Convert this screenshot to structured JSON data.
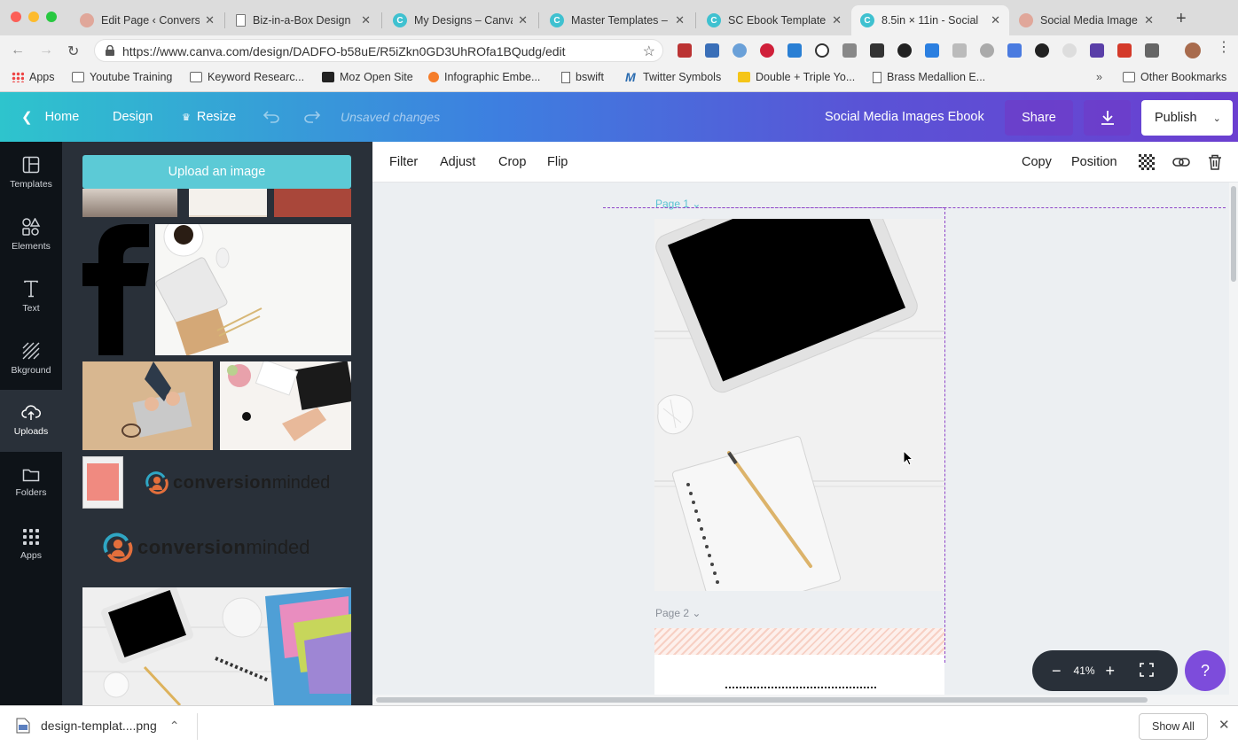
{
  "browser": {
    "tabs": [
      {
        "title": "Edit Page ‹ Conversi",
        "icon": "wordpress-icon",
        "color": "#e0a79a"
      },
      {
        "title": "Biz-in-a-Box Design",
        "icon": "document-icon",
        "color": "#ffffff"
      },
      {
        "title": "My Designs – Canva",
        "icon": "canva-icon",
        "color": "#3fc1d0"
      },
      {
        "title": "Master Templates – ",
        "icon": "canva-icon",
        "color": "#3fc1d0"
      },
      {
        "title": "SC Ebook Template",
        "icon": "canva-icon",
        "color": "#3fc1d0"
      },
      {
        "title": "8.5in × 11in - Social ",
        "icon": "canva-icon",
        "color": "#3fc1d0"
      },
      {
        "title": "Social Media Image ",
        "icon": "wordpress-icon",
        "color": "#e0a79a"
      }
    ],
    "active_tab_index": 5,
    "url": "https://www.canva.com/design/DADFO-b58uE/R5iZkn0GD3UhROfa1BQudg/edit",
    "bookmarks": [
      {
        "label": "Apps",
        "icon": "apps-grid-icon"
      },
      {
        "label": "Youtube Training",
        "icon": "folder-icon"
      },
      {
        "label": "Keyword Researc...",
        "icon": "folder-icon"
      },
      {
        "label": "Moz Open Site",
        "icon": "moz-icon"
      },
      {
        "label": "Infographic Embe...",
        "icon": "hubspot-icon"
      },
      {
        "label": "bswift",
        "icon": "page-icon"
      },
      {
        "label": "Twitter Symbols",
        "icon": "twitter-symbol-icon"
      },
      {
        "label": "Double + Triple Yo...",
        "icon": "yellow-note-icon"
      },
      {
        "label": "Brass Medallion E...",
        "icon": "page-icon"
      },
      {
        "label": "Other Bookmarks",
        "icon": "folder-icon"
      }
    ],
    "bookmarks_overflow": "»",
    "download": {
      "filename": "design-templat....png",
      "show_all": "Show All"
    }
  },
  "header": {
    "home": "Home",
    "design": "Design",
    "resize": "Resize",
    "unsaved": "Unsaved changes",
    "design_title": "Social Media Images Ebook",
    "share": "Share",
    "publish": "Publish"
  },
  "sidebar": {
    "items": [
      {
        "label": "Templates",
        "icon": "templates-icon"
      },
      {
        "label": "Elements",
        "icon": "elements-icon"
      },
      {
        "label": "Text",
        "icon": "text-icon"
      },
      {
        "label": "Bkground",
        "icon": "background-icon"
      },
      {
        "label": "Uploads",
        "icon": "upload-cloud-icon"
      },
      {
        "label": "Folders",
        "icon": "folder-icon"
      },
      {
        "label": "Apps",
        "icon": "apps-grid-icon"
      }
    ],
    "active": "Uploads"
  },
  "uploads": {
    "button": "Upload an image",
    "logo_text": {
      "main": "conversion",
      "suffix": "minded"
    }
  },
  "toolbar": {
    "left": [
      "Filter",
      "Adjust",
      "Crop",
      "Flip"
    ],
    "right": [
      "Copy",
      "Position"
    ]
  },
  "canvas": {
    "pages": [
      {
        "label": "Page 1"
      },
      {
        "label": "Page 2"
      }
    ],
    "zoom": "41%",
    "help": "?"
  },
  "colors": {
    "header_gradient_start": "#2ec4cd",
    "header_gradient_end": "#6b3fd0",
    "upload_button": "#5ccad6",
    "panel": "#293039",
    "selection": "#8e44c8"
  }
}
